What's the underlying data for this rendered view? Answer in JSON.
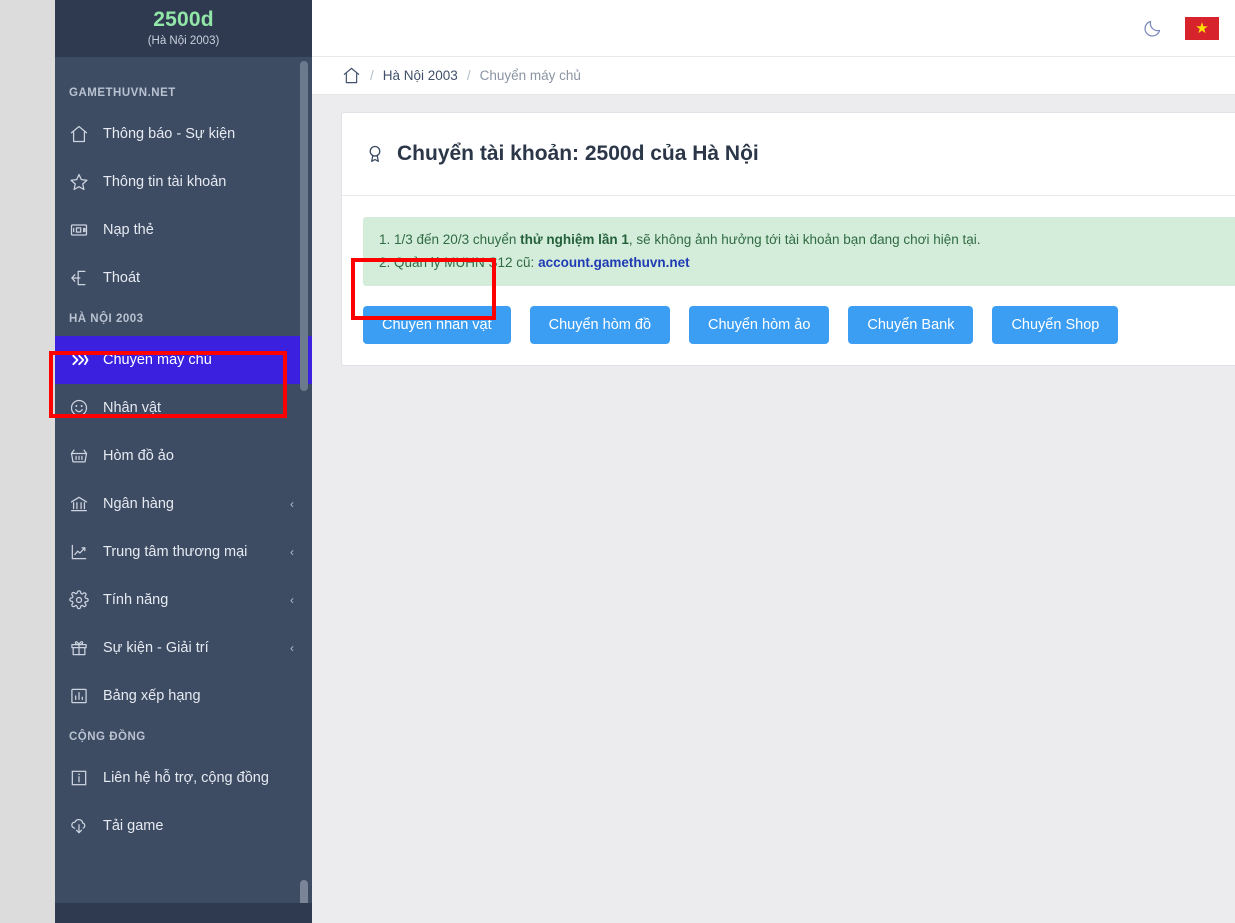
{
  "sidebar": {
    "brand": "2500d",
    "server": "(Hà Nội 2003)",
    "sections": [
      {
        "title": "GAMETHUVN.NET",
        "items": [
          {
            "label": "Thông báo - Sự kiện",
            "icon": "home-icon",
            "caret": ""
          },
          {
            "label": "Thông tin tài khoản",
            "icon": "star-icon",
            "caret": ""
          },
          {
            "label": "Nạp thẻ",
            "icon": "card-icon",
            "caret": ""
          },
          {
            "label": "Thoát",
            "icon": "logout-icon",
            "caret": ""
          }
        ]
      },
      {
        "title": "HÀ NỘI 2003",
        "items": [
          {
            "label": "Chuyển máy chủ",
            "icon": "double-chevron-icon",
            "caret": "",
            "active": true
          },
          {
            "label": "Nhân vật",
            "icon": "smiley-icon",
            "caret": ""
          },
          {
            "label": "Hòm đồ ảo",
            "icon": "basket-icon",
            "caret": ""
          },
          {
            "label": "Ngân hàng",
            "icon": "bank-icon",
            "caret": "‹"
          },
          {
            "label": "Trung tâm thương mại",
            "icon": "chart-icon",
            "caret": "‹"
          },
          {
            "label": "Tính năng",
            "icon": "gear-icon",
            "caret": "‹"
          },
          {
            "label": "Sự kiện - Giải trí",
            "icon": "gift-icon",
            "caret": "‹"
          },
          {
            "label": "Bảng xếp hạng",
            "icon": "bar-chart-icon",
            "caret": ""
          }
        ]
      },
      {
        "title": "CỘNG ĐỒNG",
        "items": [
          {
            "label": "Liên hệ hỗ trợ, cộng đồng",
            "icon": "info-icon",
            "caret": ""
          },
          {
            "label": "Tải game",
            "icon": "download-cloud-icon",
            "caret": ""
          }
        ]
      }
    ]
  },
  "topbar": {
    "dark_mode_icon": "moon-icon",
    "language_flag": "vietnam-flag",
    "flag_glyph": "★"
  },
  "breadcrumb": {
    "home_icon": "home-icon",
    "sep": "/",
    "items": [
      "Hà Nội 2003",
      "Chuyển máy chủ"
    ]
  },
  "card": {
    "icon": "medal-icon",
    "title": "Chuyển tài khoản: 2500d của Hà Nội",
    "alert": {
      "line1_prefix": "1. 1/3 đến 20/3 chuyển ",
      "line1_bold": "thử nghiệm lần 1",
      "line1_suffix": ", sẽ không ảnh hưởng tới tài khoản bạn đang chơi hiện tại.",
      "line2_prefix": "2. Quản lý MUHN S12 cũ: ",
      "line2_link": "account.gamethuvn.net"
    },
    "buttons": [
      "Chuyển nhân vật",
      "Chuyển hòm đồ",
      "Chuyển hòm ảo",
      "Chuyển Bank",
      "Chuyển Shop"
    ]
  },
  "colors": {
    "sidebar_bg": "#3d4b63",
    "sidebar_header_bg": "#2f3a51",
    "brand_green": "#92e6a7",
    "active_item": "#3b20e0",
    "button_blue": "#3c9ef3",
    "alert_green_bg": "#d4edda",
    "alert_green_text": "#2f6b43",
    "link_blue": "#1f3bb3",
    "annotation_red": "#ff0000",
    "flag_red": "#d7242c",
    "flag_star": "#ffe400"
  }
}
